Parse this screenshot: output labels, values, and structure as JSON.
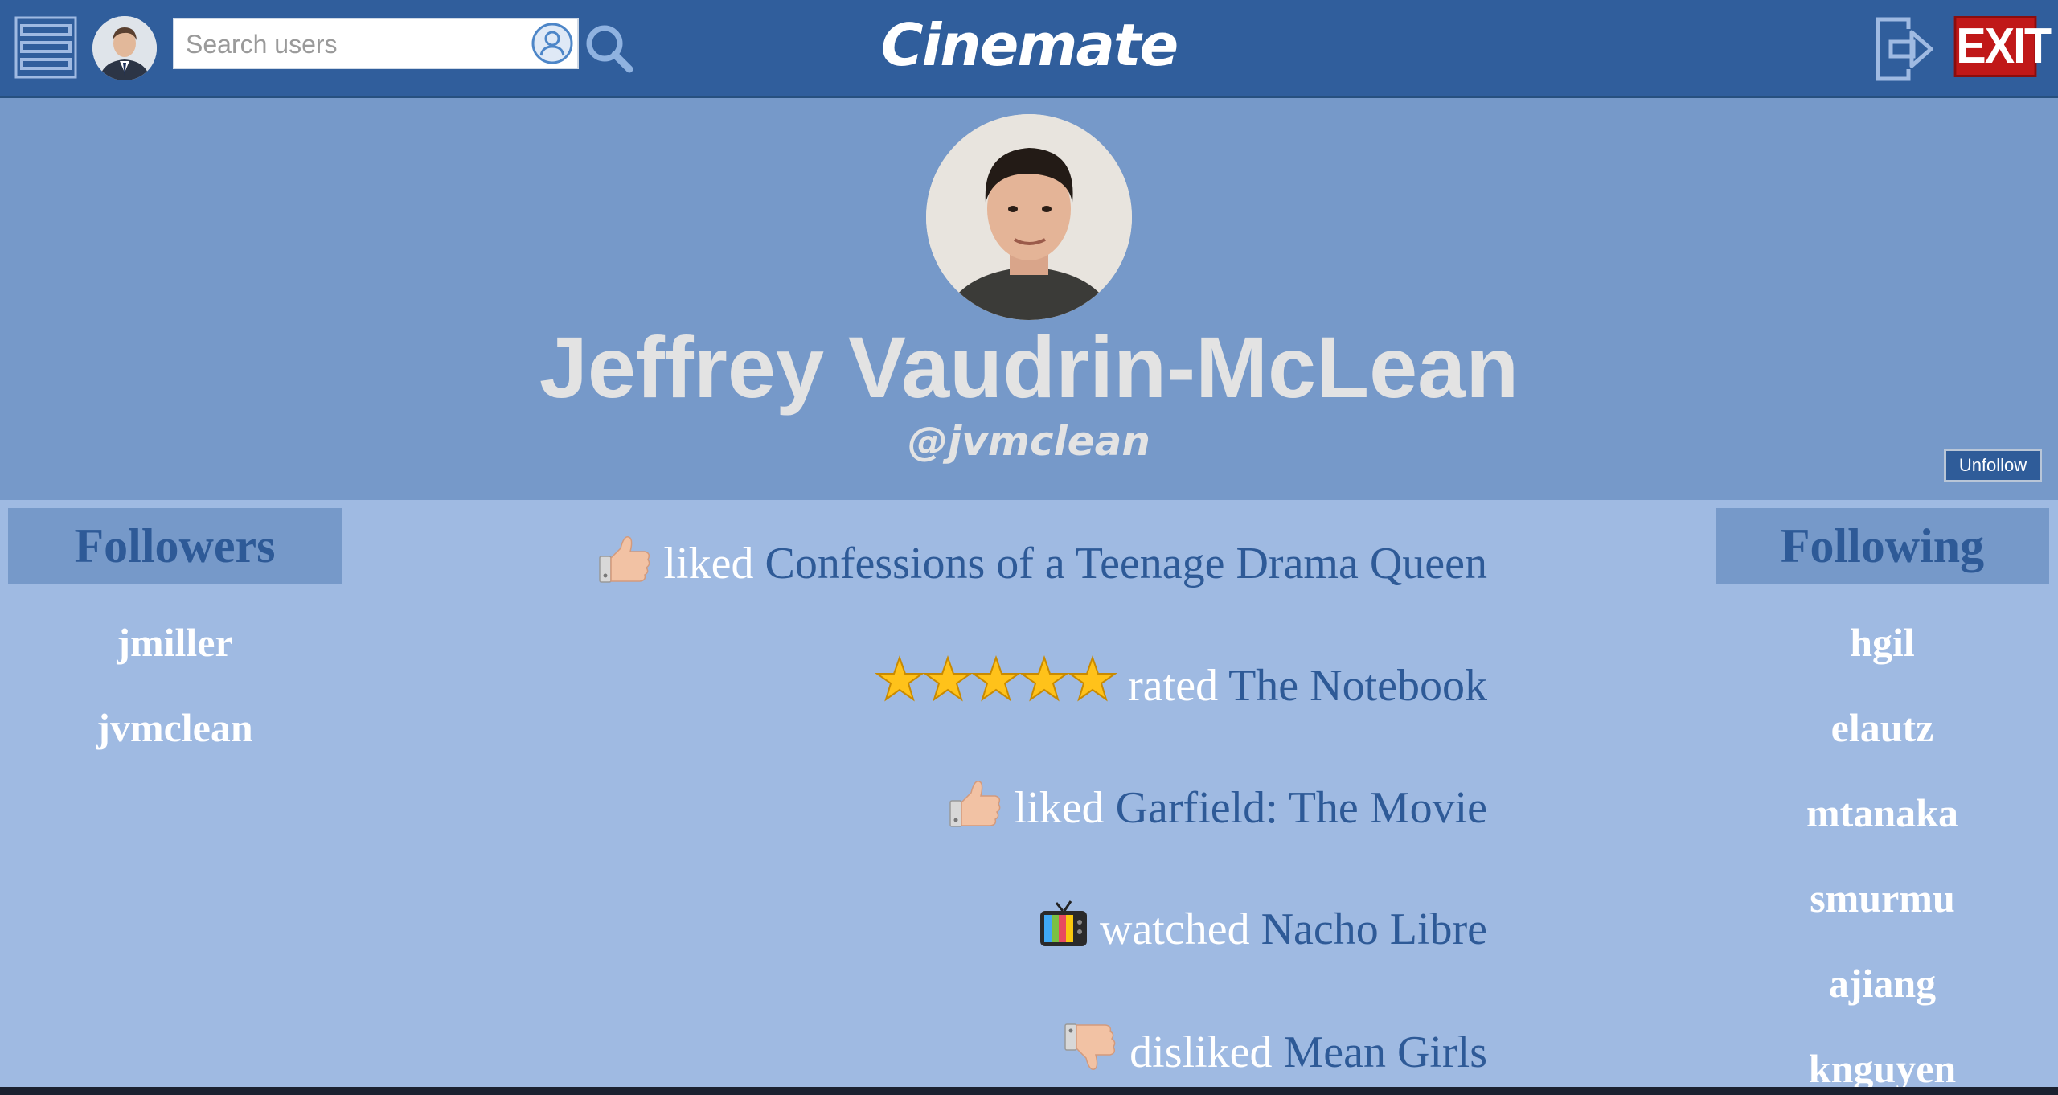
{
  "app": {
    "title": "Cinemate"
  },
  "topbar": {
    "menu_icon": "hamburger-menu-icon",
    "avatar_icon": "current-user-avatar",
    "search": {
      "placeholder": "Search users",
      "value": ""
    },
    "user_icon": "user-circle-icon",
    "search_icon": "magnifier-icon",
    "logout_icon": "logout-arrow-icon",
    "exit_label": "EXIT"
  },
  "profile": {
    "name": "Jeffrey Vaudrin-McLean",
    "handle": "@jvmclean",
    "unfollow_label": "Unfollow"
  },
  "followers": {
    "title": "Followers",
    "users": [
      "jmiller",
      "jvmclean"
    ]
  },
  "following": {
    "title": "Following",
    "users": [
      "hgil",
      "elautz",
      "mtanaka",
      "smurmu",
      "ajiang",
      "knguyen"
    ]
  },
  "feed": [
    {
      "icon": "thumbs-up-icon",
      "verb": "liked",
      "movie": "Confessions of a Teenage Drama Queen"
    },
    {
      "icon": "five-star-rating-icon",
      "rating": 5,
      "verb": "rated",
      "movie": "The Notebook"
    },
    {
      "icon": "thumbs-up-icon",
      "verb": "liked",
      "movie": "Garfield: The Movie"
    },
    {
      "icon": "television-icon",
      "verb": "watched",
      "movie": "Nacho Libre"
    },
    {
      "icon": "thumbs-down-icon",
      "verb": "disliked",
      "movie": "Mean Girls"
    }
  ],
  "colors": {
    "topbar": "#305e9c",
    "profile_bg": "#7699c9",
    "content_bg": "#9fbae2",
    "link": "#2e5a97",
    "exit": "#c01818"
  }
}
